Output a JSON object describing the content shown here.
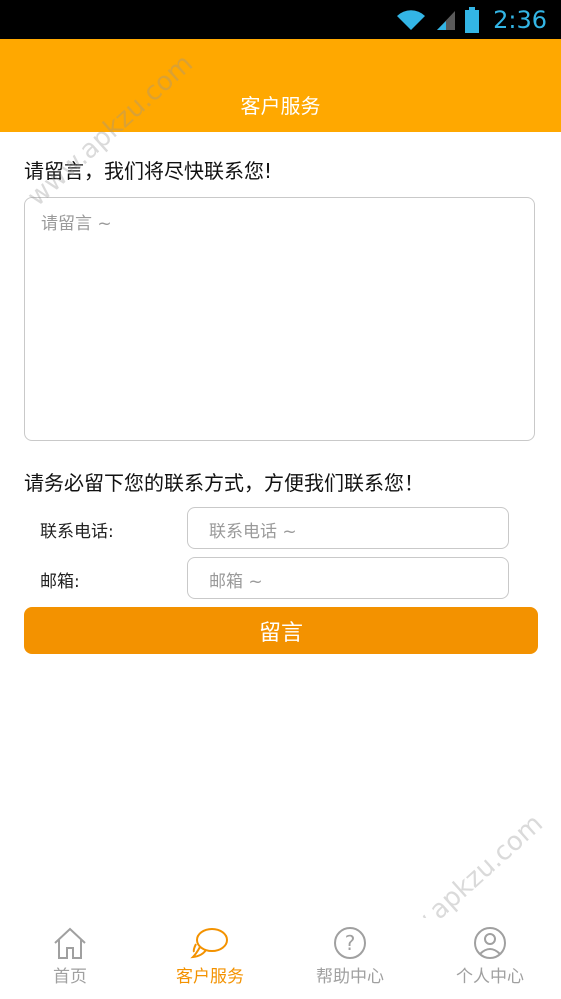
{
  "status_bar": {
    "time": "2:36",
    "icons": [
      "wifi-icon",
      "signal-icon",
      "battery-icon"
    ]
  },
  "header": {
    "title": "客户服务"
  },
  "form": {
    "message_prompt": "请留言，我们将尽快联系您!",
    "message_placeholder": "请留言 ~",
    "contact_prompt": "请务必留下您的联系方式，方便我们联系您！",
    "phone_label": "联系电话:",
    "phone_placeholder": "联系电话 ~",
    "email_label": "邮箱:",
    "email_placeholder": "邮箱 ~",
    "submit_label": "留言"
  },
  "tabs": [
    {
      "label": "首页",
      "icon": "home-icon",
      "active": false
    },
    {
      "label": "客户服务",
      "icon": "chat-bubbles-icon",
      "active": true
    },
    {
      "label": "帮助中心",
      "icon": "question-icon",
      "active": false
    },
    {
      "label": "个人中心",
      "icon": "user-icon",
      "active": false
    }
  ],
  "watermark": "www.apkzu.com",
  "colors": {
    "accent": "#ffa800",
    "button": "#f39200",
    "status_text": "#33b5e5",
    "inactive": "#a0a0a0"
  }
}
